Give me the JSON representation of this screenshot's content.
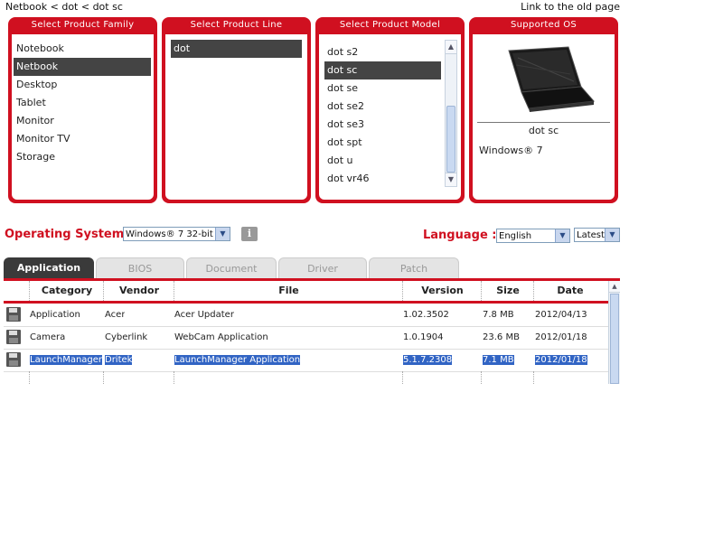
{
  "breadcrumb": "Netbook < dot < dot sc",
  "old_page_link": "Link to the old page",
  "panels": {
    "family": {
      "title": "Select Product Family",
      "items": [
        "Notebook",
        "Netbook",
        "Desktop",
        "Tablet",
        "Monitor",
        "Monitor TV",
        "Storage"
      ],
      "selected": "Netbook"
    },
    "line": {
      "title": "Select Product Line",
      "items": [
        "dot"
      ],
      "selected": "dot"
    },
    "model": {
      "title": "Select Product Model",
      "items": [
        "dot s2",
        "dot sc",
        "dot se",
        "dot se2",
        "dot se3",
        "dot spt",
        "dot u",
        "dot vr46"
      ],
      "selected": "dot sc"
    },
    "os": {
      "title": "Supported OS",
      "model": "dot sc",
      "os_name": "Windows® 7"
    }
  },
  "filters": {
    "os_label": "Operating System :",
    "os_value": "Windows® 7 32-bit",
    "info_icon": "i",
    "language_label": "Language :",
    "language_value": "English",
    "version_value": "Latest"
  },
  "tabs": [
    {
      "label": "Application",
      "active": true
    },
    {
      "label": "BIOS",
      "active": false
    },
    {
      "label": "Document",
      "active": false
    },
    {
      "label": "Driver",
      "active": false
    },
    {
      "label": "Patch",
      "active": false
    }
  ],
  "table": {
    "headers": [
      "Category",
      "Vendor",
      "File",
      "Version",
      "Size",
      "Date"
    ],
    "rows": [
      {
        "category": "Application",
        "vendor": "Acer",
        "file": "Acer Updater",
        "version": "1.02.3502",
        "size": "7.8 MB",
        "date": "2012/04/13",
        "selected": false
      },
      {
        "category": "Camera",
        "vendor": "Cyberlink",
        "file": "WebCam Application",
        "version": "1.0.1904",
        "size": "23.6 MB",
        "date": "2012/01/18",
        "selected": false
      },
      {
        "category": "LaunchManager",
        "vendor": "Dritek",
        "file": "LaunchManager Application",
        "version": "5.1.7.2308",
        "size": "7.1 MB",
        "date": "2012/01/18",
        "selected": true
      }
    ]
  },
  "colors": {
    "accent": "#d01020",
    "selection": "#3164c4",
    "dark": "#444444"
  },
  "icons": [
    "save-icon",
    "info-icon",
    "laptop-image",
    "chevron-down-icon"
  ]
}
